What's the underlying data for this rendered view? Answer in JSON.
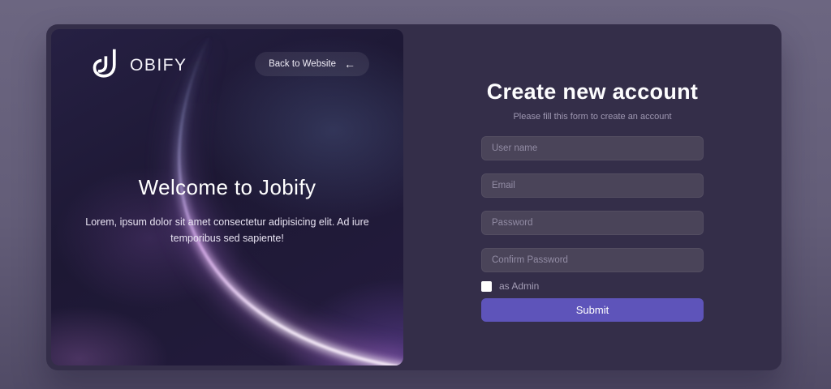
{
  "panel": {
    "logo": {
      "glyph": "double-j-monogram",
      "wordmark": "OBIFY",
      "brand": "Jobify"
    },
    "back_button": {
      "label": "Back to Website",
      "arrow": "←"
    },
    "heading": "Welcome to Jobify",
    "subtext": "Lorem, ipsum dolor sit amet consectetur adipisicing elit. Ad iure temporibus sed sapiente!"
  },
  "form": {
    "title": "Create new account",
    "subtitle": "Please fill this form to create an account",
    "fields": [
      {
        "name": "username",
        "placeholder": "User name",
        "value": ""
      },
      {
        "name": "email",
        "placeholder": "Email",
        "value": ""
      },
      {
        "name": "password",
        "placeholder": "Password",
        "value": ""
      },
      {
        "name": "confirm_password",
        "placeholder": "Confirm Password",
        "value": ""
      }
    ],
    "admin_checkbox": {
      "label": "as Admin",
      "checked": false
    },
    "submit_label": "Submit"
  },
  "colors": {
    "page_bg": "#66607a",
    "card_bg": "#342e49",
    "panel_bg": "#1d1834",
    "accent": "#5e54ba",
    "input_bg": "#4a4459",
    "muted_text": "#9f98b2"
  }
}
